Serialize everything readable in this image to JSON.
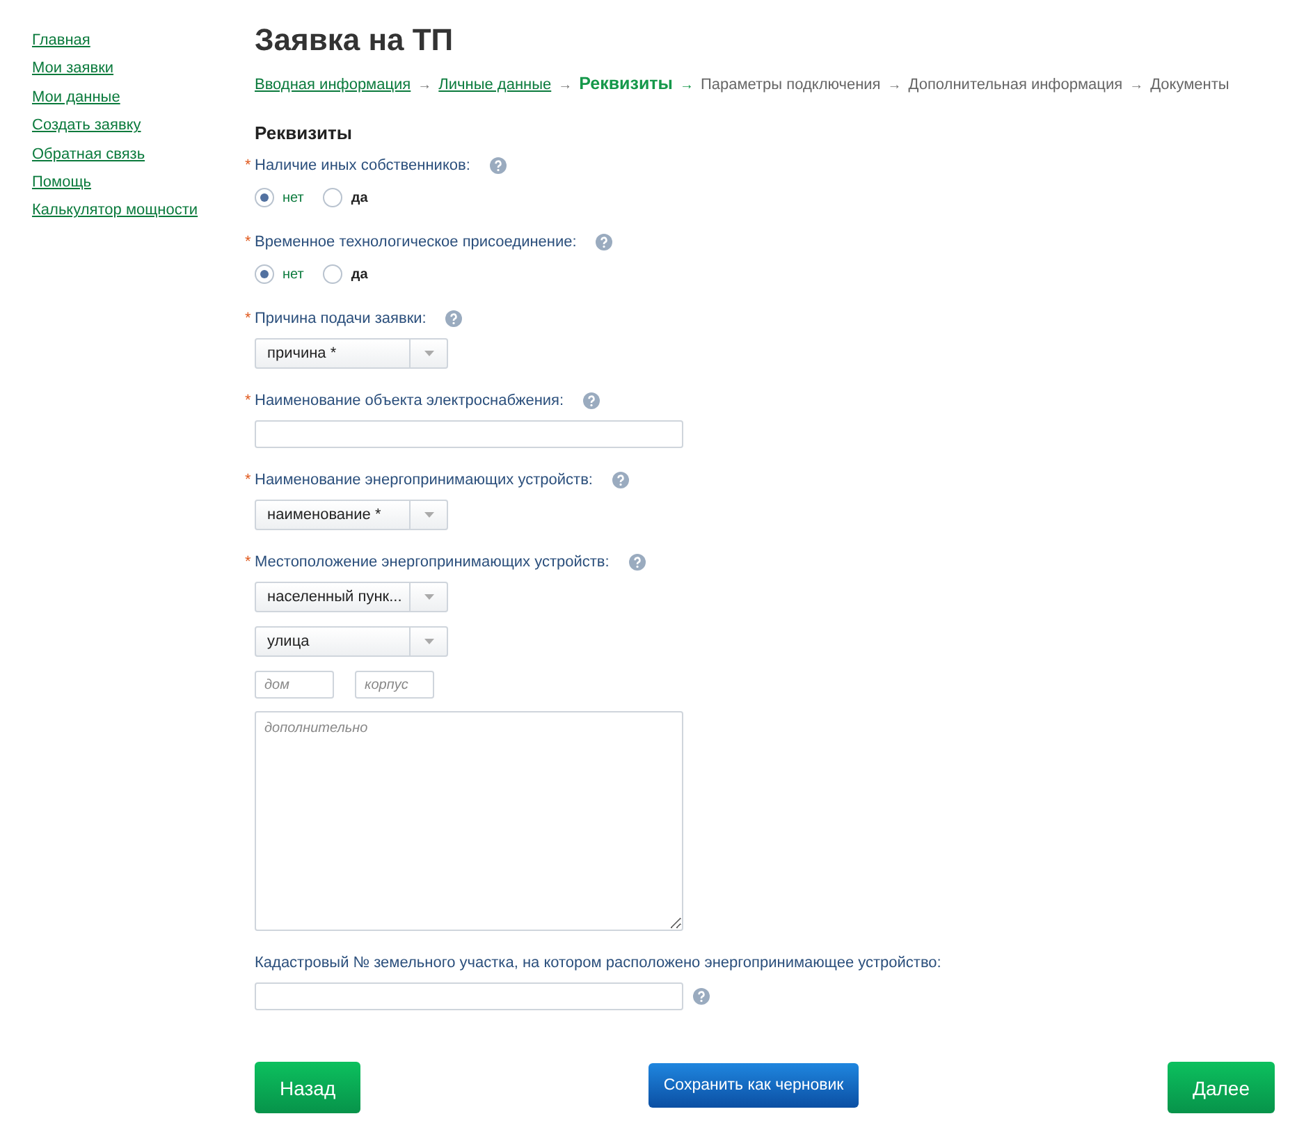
{
  "sidebar": {
    "items": [
      {
        "label": "Главная"
      },
      {
        "label": "Мои заявки"
      },
      {
        "label": "Мои данные"
      },
      {
        "label": "Создать заявку"
      },
      {
        "label": "Обратная связь"
      },
      {
        "label": "Помощь"
      },
      {
        "label": "Калькулятор мощности"
      }
    ]
  },
  "title": "Заявка на ТП",
  "steps": [
    {
      "label": "Вводная информация",
      "kind": "link",
      "arrow": "→"
    },
    {
      "label": "Личные данные",
      "kind": "link",
      "arrow": "→"
    },
    {
      "label": "Реквизиты",
      "kind": "current",
      "arrow": "→"
    },
    {
      "label": "Параметры подключения",
      "kind": "plain",
      "arrow": "→"
    },
    {
      "label": "Дополнительная информация",
      "kind": "plain",
      "arrow": "→"
    },
    {
      "label": "Документы",
      "kind": "plain"
    }
  ],
  "section_title": "Реквизиты",
  "fields": [
    {
      "required_mark": "*",
      "label": "Наличие иных собственников:",
      "label_help": true,
      "controls": [
        {
          "kind": "radios",
          "options": [
            {
              "label": "нет",
              "selected": true
            },
            {
              "label": "да",
              "selected": false
            }
          ]
        }
      ]
    },
    {
      "required_mark": "*",
      "label": "Временное технологическое присоединение:",
      "label_help": true,
      "controls": [
        {
          "kind": "radios",
          "options": [
            {
              "label": "нет",
              "selected": true
            },
            {
              "label": "да",
              "selected": false
            }
          ]
        }
      ]
    },
    {
      "required_mark": "*",
      "label": "Причина подачи заявки:",
      "label_help": true,
      "controls": [
        {
          "kind": "select",
          "value": "причина *"
        }
      ]
    },
    {
      "required_mark": "*",
      "label": "Наименование объекта электроснабжения:",
      "label_help": true,
      "controls": [
        {
          "kind": "input"
        }
      ]
    },
    {
      "required_mark": "*",
      "label": "Наименование энергопринимающих устройств:",
      "label_help": true,
      "controls": [
        {
          "kind": "select",
          "value": "наименование *"
        }
      ]
    },
    {
      "required_mark": "*",
      "label": "Местоположение энергопринимающих устройств:",
      "label_help": true,
      "controls": [
        {
          "kind": "select",
          "value": "населенный пунк..."
        },
        {
          "kind": "select",
          "value": "улица"
        },
        {
          "kind": "pair",
          "items": [
            {
              "placeholder": "дом"
            },
            {
              "placeholder": "корпус"
            }
          ]
        },
        {
          "kind": "textarea",
          "placeholder": "дополнительно"
        }
      ]
    },
    {
      "label": "Кадастровый № земельного участка, на котором расположено энергопринимающее устройство:",
      "input_help": true,
      "controls": [
        {
          "kind": "input"
        }
      ]
    }
  ],
  "buttons": [
    {
      "label": "Назад",
      "kind": "green"
    },
    {
      "label": "Сохранить как черновик",
      "kind": "blue"
    },
    {
      "label": "Далее",
      "kind": "green"
    }
  ]
}
